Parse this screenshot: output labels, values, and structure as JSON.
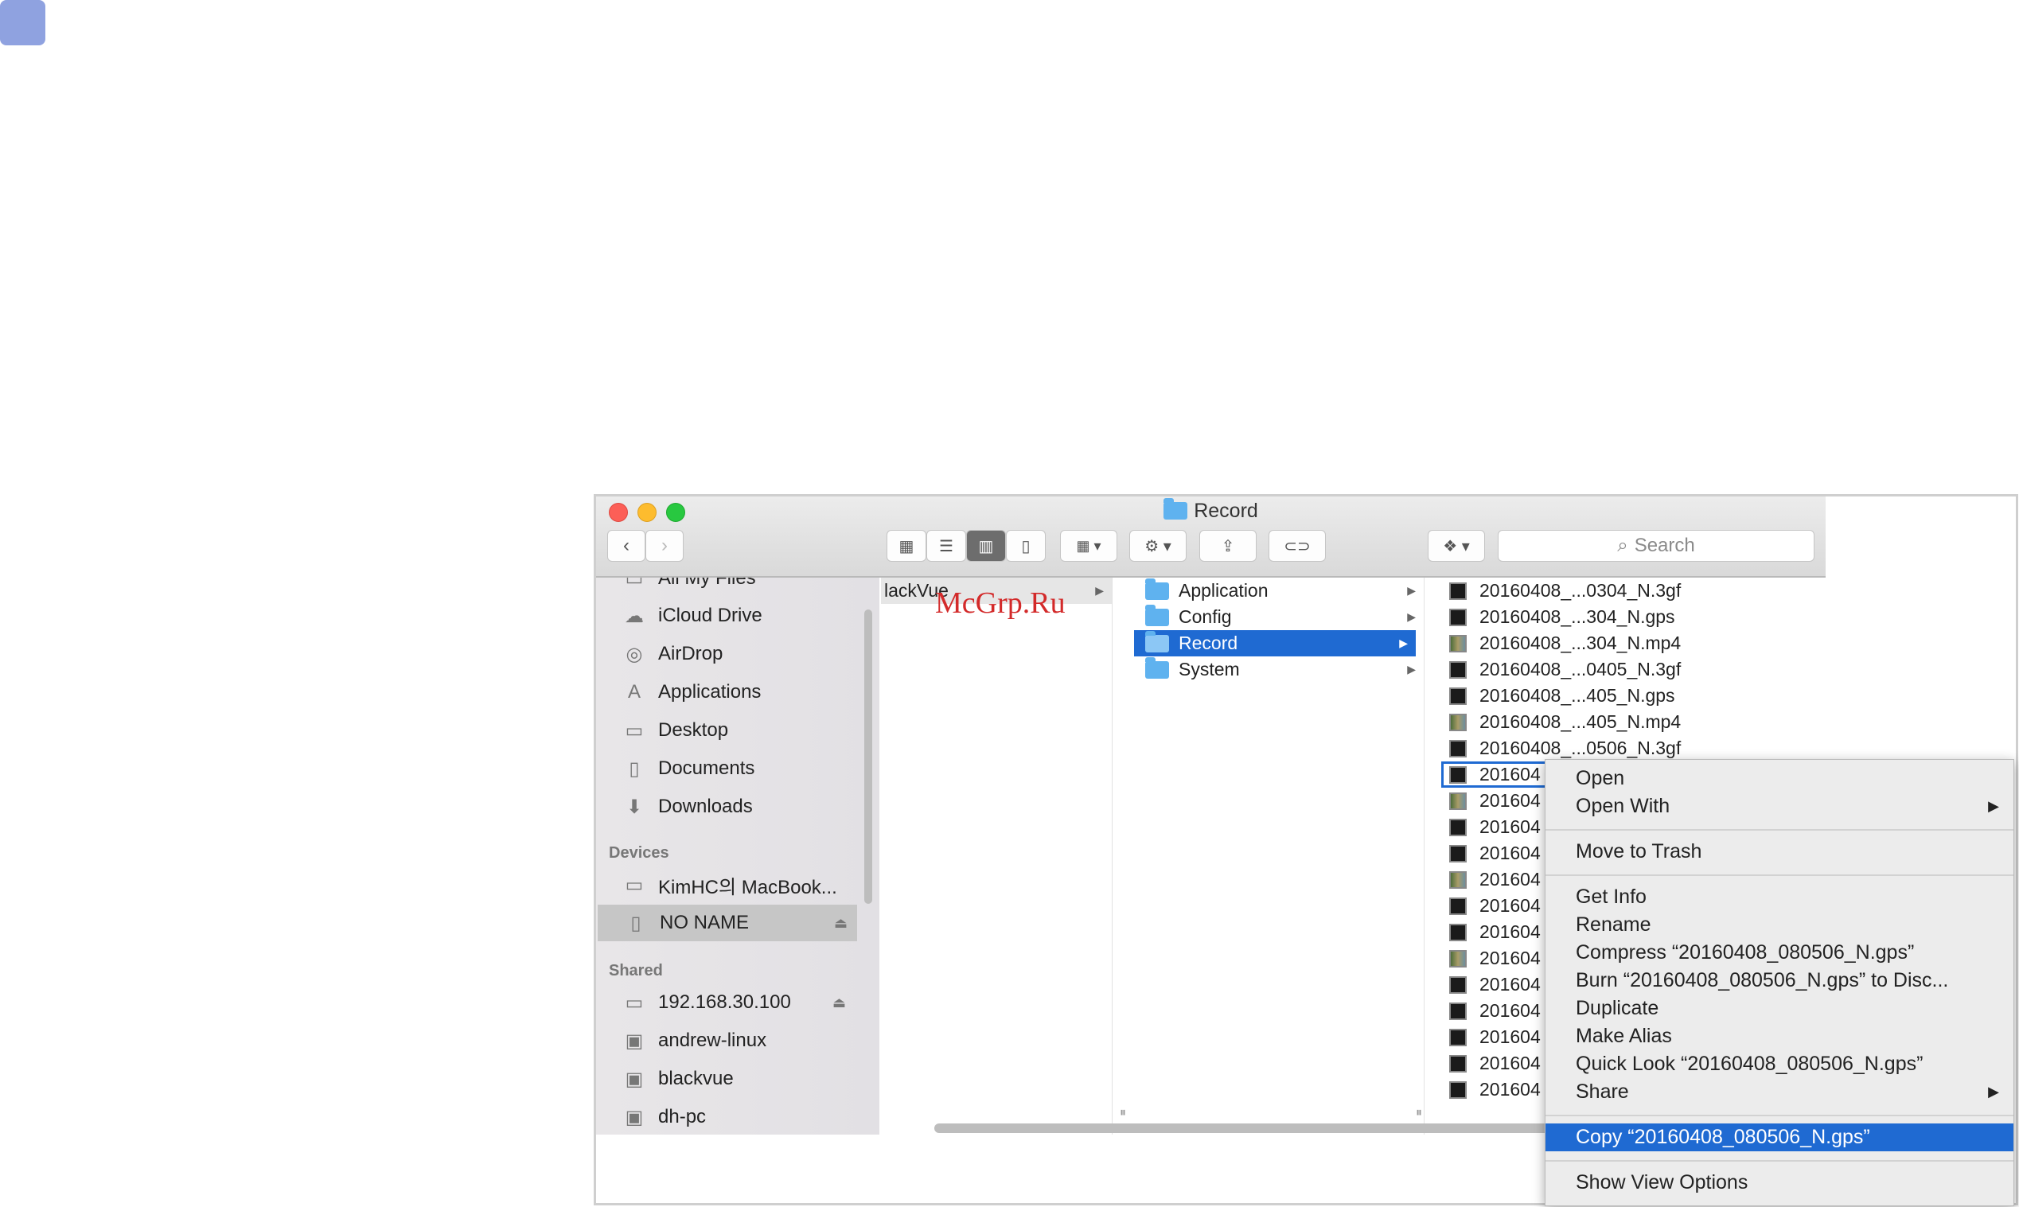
{
  "window": {
    "title": "Record",
    "search_placeholder": "Search"
  },
  "toolbar": {
    "back_icon": "chevron-left-icon",
    "forward_icon": "chevron-right-icon"
  },
  "sidebar": {
    "items": [
      {
        "label": "All My Files",
        "icon": "all-files-icon"
      },
      {
        "label": "iCloud Drive",
        "icon": "cloud-icon"
      },
      {
        "label": "AirDrop",
        "icon": "airdrop-icon"
      },
      {
        "label": "Applications",
        "icon": "applications-icon"
      },
      {
        "label": "Desktop",
        "icon": "desktop-icon"
      },
      {
        "label": "Documents",
        "icon": "documents-icon"
      },
      {
        "label": "Downloads",
        "icon": "downloads-icon"
      }
    ],
    "devices_header": "Devices",
    "devices": [
      {
        "label": "KimHC의 MacBook..."
      },
      {
        "label": "NO NAME"
      }
    ],
    "shared_header": "Shared",
    "shared": [
      {
        "label": "192.168.30.100"
      },
      {
        "label": "andrew-linux"
      },
      {
        "label": "blackvue"
      },
      {
        "label": "dh-pc"
      }
    ]
  },
  "column1": {
    "item": "lackVue"
  },
  "column2": {
    "items": [
      "Application",
      "Config",
      "Record",
      "System"
    ],
    "selected": "Record"
  },
  "column3": {
    "files": [
      "20160408_...0304_N.3gf",
      "20160408_...304_N.gps",
      "20160408_...304_N.mp4",
      "20160408_...0405_N.3gf",
      "20160408_...405_N.gps",
      "20160408_...405_N.mp4",
      "20160408_...0506_N.3gf",
      "201604",
      "201604",
      "201604",
      "201604",
      "201604",
      "201604",
      "201604",
      "201604",
      "201604",
      "201604",
      "201604",
      "201604",
      "201604"
    ]
  },
  "watermark": "McGrp.Ru",
  "context_menu": {
    "open": "Open",
    "open_with": "Open With",
    "move_to_trash": "Move to Trash",
    "get_info": "Get Info",
    "rename": "Rename",
    "compress": "Compress “20160408_080506_N.gps”",
    "burn": "Burn “20160408_080506_N.gps” to Disc...",
    "duplicate": "Duplicate",
    "make_alias": "Make Alias",
    "quick_look": "Quick Look “20160408_080506_N.gps”",
    "share": "Share",
    "copy": "Copy “20160408_080506_N.gps”",
    "show_view_options": "Show View Options"
  }
}
